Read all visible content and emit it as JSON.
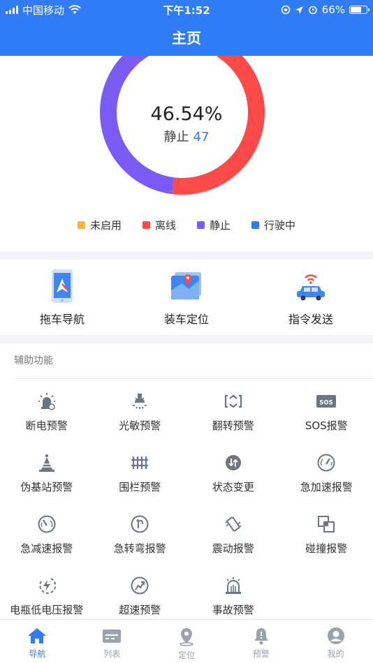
{
  "status_bar": {
    "carrier": "中国移动",
    "time": "下午1:52",
    "battery_percent": "66%",
    "battery_level": 0.66
  },
  "header": {
    "title": "主页"
  },
  "summary": {
    "percent": "46.54%",
    "status_label": "静止",
    "status_count": "47"
  },
  "chart_data": {
    "type": "pie",
    "subtype": "donut",
    "categories": [
      "未启用",
      "离线",
      "静止",
      "行驶中"
    ],
    "values": [
      9.0,
      43.0,
      46.54,
      1.46
    ],
    "colors": [
      "#ffb236",
      "#ff4a4a",
      "#7c5af5",
      "#2f7cf6"
    ],
    "center_label": "46.54%",
    "legend_position": "bottom"
  },
  "legend": [
    {
      "label": "未启用",
      "color": "#ffb236"
    },
    {
      "label": "离线",
      "color": "#ff4a4a"
    },
    {
      "label": "静止",
      "color": "#7c5af5"
    },
    {
      "label": "行驶中",
      "color": "#2f7cf6"
    }
  ],
  "main_functions": [
    {
      "label": "拖车导航",
      "icon": "phone-navigation-icon"
    },
    {
      "label": "装车定位",
      "icon": "map-location-icon"
    },
    {
      "label": "指令发送",
      "icon": "car-signal-icon"
    }
  ],
  "aux": {
    "title": "辅助功能",
    "items": [
      {
        "label": "断电预警",
        "icon": "power-alarm-icon"
      },
      {
        "label": "光敏预警",
        "icon": "light-sensor-icon"
      },
      {
        "label": "翻转预警",
        "icon": "flip-icon"
      },
      {
        "label": "SOS报警",
        "icon": "sos-icon",
        "icon_text": "SOS"
      },
      {
        "label": "伪基站预警",
        "icon": "fake-base-station-icon"
      },
      {
        "label": "围栏预警",
        "icon": "fence-icon"
      },
      {
        "label": "状态变更",
        "icon": "status-change-icon"
      },
      {
        "label": "急加速报警",
        "icon": "acceleration-icon"
      },
      {
        "label": "急减速报警",
        "icon": "deceleration-icon"
      },
      {
        "label": "急转弯报警",
        "icon": "sharp-turn-icon"
      },
      {
        "label": "震动报警",
        "icon": "vibration-icon"
      },
      {
        "label": "碰撞报警",
        "icon": "collision-icon"
      },
      {
        "label": "电瓶低电压报警",
        "icon": "low-voltage-icon"
      },
      {
        "label": "超速预警",
        "icon": "overspeed-icon"
      },
      {
        "label": "事故预警",
        "icon": "accident-alarm-icon"
      }
    ]
  },
  "tabbar": [
    {
      "label": "导航",
      "icon": "home-icon",
      "active": true
    },
    {
      "label": "列表",
      "icon": "list-icon",
      "active": false
    },
    {
      "label": "定位",
      "icon": "location-pin-icon",
      "active": false
    },
    {
      "label": "预警",
      "icon": "bell-icon",
      "active": false
    },
    {
      "label": "我的",
      "icon": "profile-icon",
      "active": false
    }
  ],
  "colors": {
    "brand": "#2f7cf6",
    "icon_gray": "#6b7684",
    "tab_inactive": "#9aa3ad"
  }
}
